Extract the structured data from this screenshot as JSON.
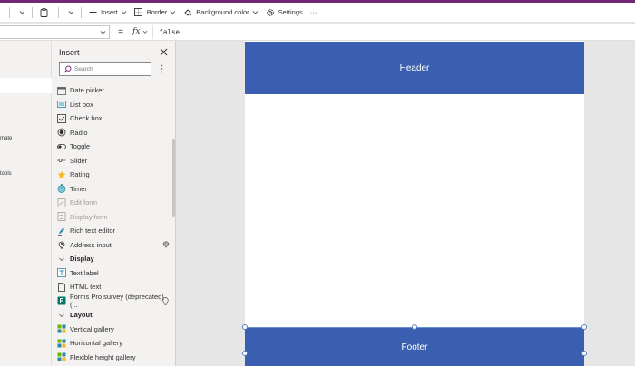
{
  "toolbar": {
    "insert_label": "Insert",
    "border_label": "Border",
    "background_label": "Background color",
    "settings_label": "Settings",
    "more_label": "···"
  },
  "formula": {
    "equals": "=",
    "fx": "fx",
    "value": "false"
  },
  "tree": {
    "fragment_1": "mate",
    "fragment_2": "tools"
  },
  "insert_pane": {
    "title": "Insert",
    "search_placeholder": "Search",
    "items": [
      {
        "label": "Date picker",
        "icon": "calendar-icon"
      },
      {
        "label": "List box",
        "icon": "listbox-icon"
      },
      {
        "label": "Check box",
        "icon": "checkbox-icon"
      },
      {
        "label": "Radio",
        "icon": "radio-icon"
      },
      {
        "label": "Toggle",
        "icon": "toggle-icon"
      },
      {
        "label": "Slider",
        "icon": "slider-icon"
      },
      {
        "label": "Rating",
        "icon": "star-icon"
      },
      {
        "label": "Timer",
        "icon": "timer-icon"
      },
      {
        "label": "Edit form",
        "icon": "edit-form-icon",
        "disabled": true
      },
      {
        "label": "Display form",
        "icon": "display-form-icon",
        "disabled": true
      },
      {
        "label": "Rich text editor",
        "icon": "pen-icon"
      },
      {
        "label": "Address input",
        "icon": "pin-icon"
      },
      {
        "label": "Display",
        "category": true
      },
      {
        "label": "Text label",
        "icon": "text-label-icon"
      },
      {
        "label": "HTML text",
        "icon": "html-icon"
      },
      {
        "label": "Forms Pro survey (deprecated) (...",
        "icon": "forms-icon"
      },
      {
        "label": "Layout",
        "category": true
      },
      {
        "label": "Vertical gallery",
        "icon": "gallery-icon"
      },
      {
        "label": "Horizontal gallery",
        "icon": "gallery-icon"
      },
      {
        "label": "Flexible height gallery",
        "icon": "gallery-icon"
      }
    ]
  },
  "canvas": {
    "header_text": "Header",
    "footer_text": "Footer"
  },
  "colors": {
    "brand_purple": "#742774",
    "header_blue": "#3a5fb0",
    "pane_bg": "#f3f2f1",
    "workspace_bg": "#e6e6e6"
  }
}
